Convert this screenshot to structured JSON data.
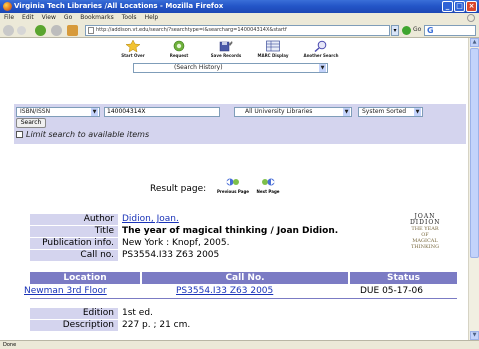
{
  "window": {
    "title": "Virginia Tech Libraries /All Locations - Mozilla Firefox",
    "buttons": [
      "_",
      "□",
      "×"
    ]
  },
  "menu": [
    "File",
    "Edit",
    "View",
    "Go",
    "Bookmarks",
    "Tools",
    "Help"
  ],
  "nav": {
    "url": "http://addison.vt.edu/search/?searchtype=i&searcharg=140004314X&startf",
    "go_label": "Go",
    "search_engine": "G"
  },
  "toolbar": {
    "items": [
      "Start Over",
      "Request",
      "Save Records",
      "MARC Display",
      "Another Search"
    ],
    "history_select": "(Search History)"
  },
  "search": {
    "type": "ISBN/ISSN",
    "query": "140004314X",
    "scope": "All University Libraries",
    "sort": "System Sorted",
    "button": "Search",
    "limit_label": "Limit search to available items"
  },
  "result_nav": {
    "label": "Result page:",
    "prev": "Previous Page",
    "next": "Next Page"
  },
  "record": {
    "author_label": "Author",
    "author": "Didion, Joan.",
    "title_label": "Title",
    "title": "The year of magical thinking / Joan Didion.",
    "pub_label": "Publication info.",
    "pub": "New York : Knopf, 2005.",
    "call_label": "Call no.",
    "call": "PS3554.I33 Z63 2005",
    "edition_label": "Edition",
    "edition": "1st ed.",
    "desc_label": "Description",
    "desc": "227 p. ; 21 cm."
  },
  "cover": {
    "line1": "JOAN",
    "line2": "DIDION",
    "line3": "THE YEAR OF MAGICAL THINKING"
  },
  "holdings": {
    "headers": [
      "Location",
      "Call No.",
      "Status"
    ],
    "rows": [
      {
        "location": "Newman 3rd Floor",
        "callno": "PS3554.I33 Z63 2005",
        "status": "DUE 05-17-06"
      }
    ]
  },
  "statusbar": "Done",
  "colors": {
    "panel": "#d4d4ee",
    "header": "#7b7bc4",
    "link": "#1a33b8"
  }
}
